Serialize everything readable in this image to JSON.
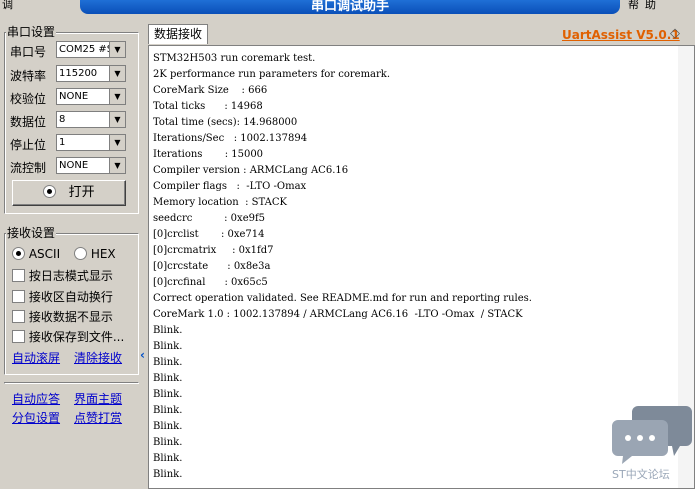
{
  "window": {
    "title": "串口调试助手",
    "menu_left": "调",
    "menu_right": [
      "帮",
      "助"
    ]
  },
  "serial_settings": {
    "group_title": "串口设置",
    "rows": [
      {
        "label": "串口号",
        "value": "COM25 #ST"
      },
      {
        "label": "波特率",
        "value": "115200"
      },
      {
        "label": "校验位",
        "value": "NONE"
      },
      {
        "label": "数据位",
        "value": "8"
      },
      {
        "label": "停止位",
        "value": "1"
      },
      {
        "label": "流控制",
        "value": "NONE"
      }
    ],
    "open_button": "打开"
  },
  "recv_settings": {
    "group_title": "接收设置",
    "radio_ascii": "ASCII",
    "radio_hex": "HEX",
    "options": [
      "按日志模式显示",
      "接收区自动换行",
      "接收数据不显示",
      "接收保存到文件..."
    ],
    "link_autoscroll": "自动滚屏",
    "link_clear": "清除接收"
  },
  "bottom_links": {
    "auto_reply": "自动应答",
    "ui_theme": "界面主题",
    "packet_settings": "分包设置",
    "tip": "点赞打赏"
  },
  "main": {
    "tab_label": "数据接收",
    "brand": "UartAssist V5.0.1",
    "received_lines": [
      "STM32H503 run coremark test.",
      "2K performance run parameters for coremark.",
      "CoreMark Size    : 666",
      "Total ticks      : 14968",
      "Total time (secs): 14.968000",
      "Iterations/Sec   : 1002.137894",
      "Iterations       : 15000",
      "Compiler version : ARMCLang AC6.16",
      "Compiler flags   :  -LTO -Omax",
      "Memory location  : STACK",
      "seedcrc          : 0xe9f5",
      "[0]crclist       : 0xe714",
      "[0]crcmatrix     : 0x1fd7",
      "[0]crcstate      : 0x8e3a",
      "[0]crcfinal      : 0x65c5",
      "Correct operation validated. See README.md for run and reporting rules.",
      "CoreMark 1.0 : 1002.137894 / ARMCLang AC6.16  -LTO -Omax  / STACK",
      "Blink.",
      "Blink.",
      "Blink.",
      "Blink.",
      "Blink.",
      "Blink.",
      "Blink.",
      "Blink.",
      "Blink.",
      "Blink."
    ]
  },
  "watermark": {
    "text": "ST中文论坛"
  }
}
